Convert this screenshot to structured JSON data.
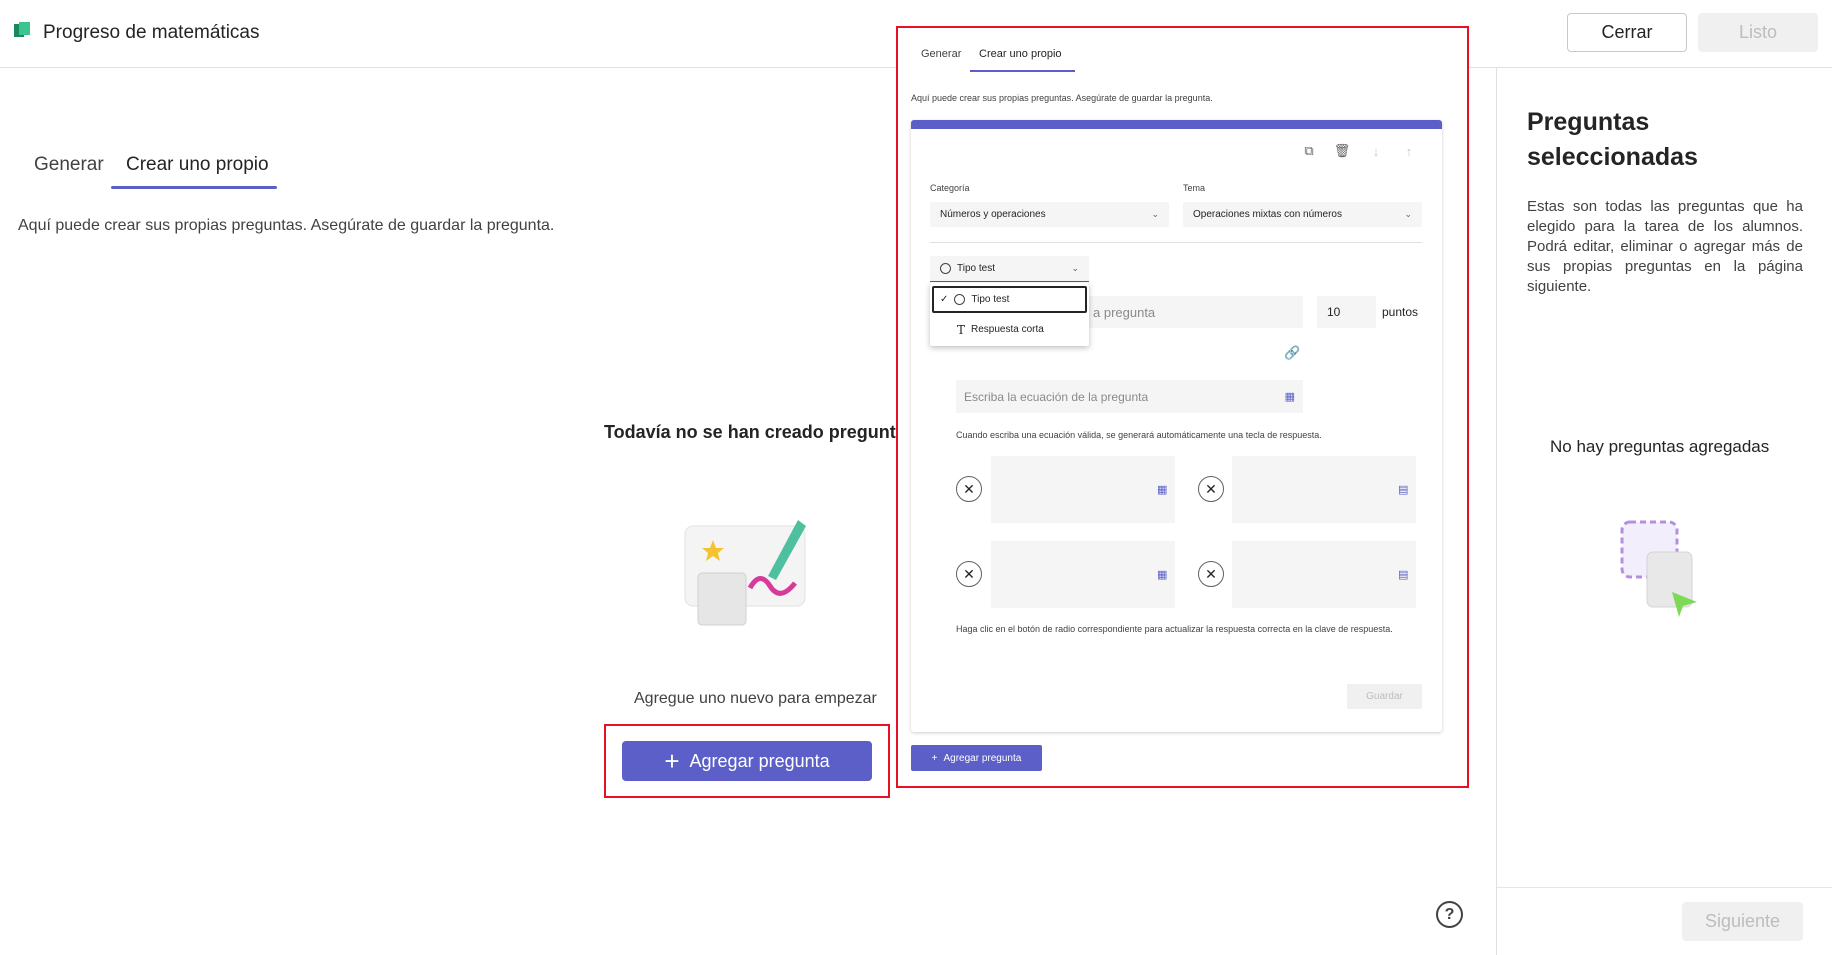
{
  "header": {
    "app_title": "Progreso de matemáticas",
    "close_label": "Cerrar",
    "done_label": "Listo"
  },
  "tabs": [
    {
      "label": "Generar"
    },
    {
      "label": "Crear uno propio"
    }
  ],
  "intro_text": "Aquí puede crear sus propias preguntas. Asegúrate de guardar la pregunta.",
  "empty_state": {
    "title": "Todavía no se han creado preguntas",
    "subtitle": "Agregue uno nuevo para empezar",
    "add_button_label": "Agregar pregunta"
  },
  "right_panel": {
    "title": "Preguntas seleccionadas",
    "description": "Estas son todas las preguntas que ha elegido para la tarea de los alumnos. Podrá editar, eliminar o agregar más de sus propias preguntas en la página siguiente.",
    "empty_label": "No hay preguntas agregadas",
    "next_label": "Siguiente"
  },
  "overlay": {
    "tabs": [
      {
        "label": "Generar"
      },
      {
        "label": "Crear uno propio"
      }
    ],
    "intro_text": "Aquí puede crear sus propias preguntas. Asegúrate de guardar la pregunta.",
    "category_label": "Categoría",
    "category_value": "Números y operaciones",
    "topic_label": "Tema",
    "topic_value": "Operaciones mixtas con números",
    "type_value": "Tipo test",
    "type_options": [
      "Tipo test",
      "Respuesta corta"
    ],
    "question_placeholder_partial": "a pregunta",
    "points_value": "10",
    "points_label": "puntos",
    "equation_placeholder": "Escriba la ecuación de la pregunta",
    "equation_hint": "Cuando escriba una ecuación válida, se generará automáticamente una tecla de respuesta.",
    "radio_hint": "Haga clic en el botón de radio correspondiente para actualizar la respuesta correcta en la clave de respuesta.",
    "save_label": "Guardar",
    "add_button_label": "Agregar pregunta"
  },
  "colors": {
    "accent": "#5b5fc7",
    "highlight": "#e81123"
  }
}
